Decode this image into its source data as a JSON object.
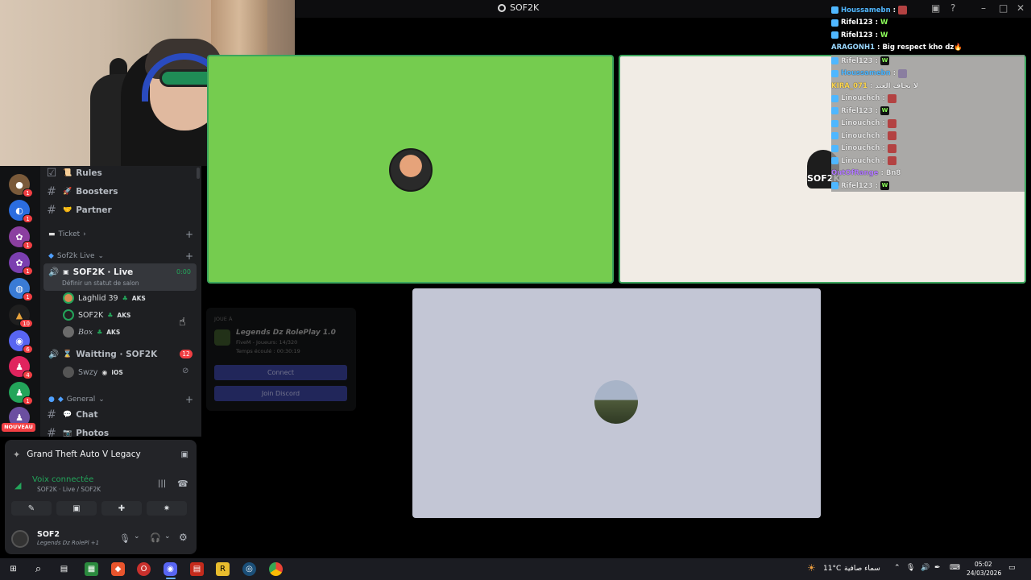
{
  "window": {
    "title": "SOF2K"
  },
  "channels": {
    "text_top": [
      {
        "emoji": "☑ 📜",
        "name": "Rules"
      },
      {
        "emoji": "🚀",
        "name": "Boosters"
      },
      {
        "emoji": "🤝",
        "name": "Partner"
      }
    ],
    "category_ticket": "Ticket",
    "category_live": "Sof2k Live",
    "live_channel": {
      "name": "SOF2K · Live",
      "timer": "0:00",
      "status": "Définir un statut de salon"
    },
    "voice_users": [
      {
        "name": "Laghlid 39",
        "tag": "AKS"
      },
      {
        "name": "SOF2K",
        "tag": "AKS"
      },
      {
        "name": "Box",
        "tag": "AKS"
      }
    ],
    "waiting_channel": {
      "name": "Waitting · SOF2K",
      "badge": "12"
    },
    "waiting_users": [
      {
        "name": "Swzy",
        "tag": "iOS"
      }
    ],
    "category_general": "General",
    "text_bottom": [
      {
        "emoji": "💬",
        "name": "Chat"
      },
      {
        "emoji": "📷",
        "name": "Photos"
      }
    ]
  },
  "servers": [
    {
      "badge": "1",
      "color": "#7a5a3a"
    },
    {
      "badge": "1",
      "color": "#2b6de0"
    },
    {
      "badge": "1",
      "color": "#8b3fa0"
    },
    {
      "badge": "1",
      "color": "#7b3fb0"
    },
    {
      "badge": "1",
      "color": "#3a7bd5"
    },
    {
      "badge": "10",
      "color": "#1f1f1f"
    },
    {
      "badge": "6",
      "color": "#5865f2"
    },
    {
      "badge": "4",
      "color": "#e0245e"
    },
    {
      "badge": "1",
      "color": "#23a55a"
    },
    {
      "badge": "",
      "color": "#6b4fa0"
    }
  ],
  "nouveau_label": "NOUVEAU",
  "activity": {
    "game": "Grand Theft Auto V Legacy",
    "voice_status": "Voix connectée",
    "voice_channel": "SOF2K · Live / SOF2K",
    "user_name": "SOF2",
    "user_activity": "Legends Dz RolePl +1"
  },
  "game_card": {
    "label": "JOUE À",
    "title": "Legends Dz RolePlay 1.0",
    "line1": "FiveM - Joueurs: 14/320",
    "line2": "Temps écoulé : 00:30:19",
    "connect_label": "Connect",
    "discord_label": "Join Discord"
  },
  "chat_top": [
    {
      "user": "Houssamebn",
      "msg": "",
      "color": "#4fb7ff"
    },
    {
      "user": "Rifel123",
      "msg": "W",
      "color": "#ffffff"
    },
    {
      "user": "Rifel123",
      "msg": "W",
      "color": "#ffffff"
    },
    {
      "user": "ARAGONH1",
      "msg": "Big respect kho dz🔥",
      "color": "#ffffff"
    }
  ],
  "chat_box": [
    {
      "user": "Rifel123",
      "msg": "W"
    },
    {
      "user": "Houssamebn",
      "msg": ""
    },
    {
      "user": "KIRA_071",
      "msg": "لا تخاف العيد"
    },
    {
      "user": "Linouchch",
      "msg": ""
    },
    {
      "user": "Rifel123",
      "msg": "W"
    },
    {
      "user": "Linouchch",
      "msg": ""
    },
    {
      "user": "Linouchch",
      "msg": ""
    },
    {
      "user": "Linouchch",
      "msg": ""
    },
    {
      "user": "Linouchch",
      "msg": ""
    },
    {
      "user": "OutOfRange",
      "msg": "Bn8"
    },
    {
      "user": "Rifel123",
      "msg": "W"
    }
  ],
  "stream_overlay_text": "SOF2K",
  "taskbar": {
    "temperature": "11°C",
    "weather": "سماء صافية",
    "time": "05:02",
    "date": "24/03/2026"
  },
  "colors": {
    "tile_green": "#75cc4f",
    "tile_cream": "#f1ece5",
    "tile_gray": "#c3c6d5",
    "speaking_border": "#3ba55d",
    "discord_red": "#f23f43",
    "voice_green": "#23a55a"
  }
}
